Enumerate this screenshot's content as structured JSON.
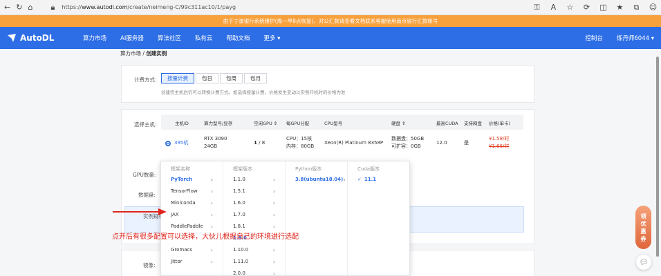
{
  "browser": {
    "url_prefix": "https://",
    "url_host": "www.autodl.com",
    "url_path": "/create/neimeng-C/99c311ac10/1/payg"
  },
  "notice": {
    "text": "由于宁波银行系统维护(周一早8点恢复)，对公汇款请查看文档联系客服使用南京银行汇款账号"
  },
  "nav": {
    "brand": "AutoDL",
    "items": [
      "算力市场",
      "AI服务器",
      "算法社区",
      "私有云",
      "帮助文档",
      "更多"
    ],
    "console": "控制台",
    "user": "炼丹师6044"
  },
  "breadcrumb": {
    "root": "算力市场",
    "separator": "/",
    "current": "创建实例"
  },
  "billing": {
    "label": "计费方式:",
    "options": [
      "按量计费",
      "包日",
      "包周",
      "包月"
    ],
    "selected": "按量计费",
    "hint": "创建完主机后仍可以转换计费方式。如选择按量计费，价格发生变动以实例开机时的价格为准"
  },
  "host": {
    "label": "选择主机:",
    "headers": [
      "主机ID",
      "算力型号/显存",
      "空闲GPU",
      "每GPU分配",
      "CPU型号",
      "硬盘",
      "最高CUDA",
      "支持网盘",
      "价格(单卡)"
    ],
    "row": {
      "id": "395机",
      "gpu_model": "RTX 3090",
      "gpu_mem": "24GB",
      "free_gpu": "1",
      "total_gpu": "/ 8",
      "cpu_alloc": "CPU：15核",
      "mem_alloc": "内存：80GB",
      "cpu_model": "Xeon(R) Platinum 8358P",
      "disk_data": "数据盘：50GB",
      "disk_expand": "可扩容：0GB",
      "cuda": "12.0",
      "netdisk": "是",
      "price_new": "¥1.58/时",
      "price_old": "¥1.66/时"
    }
  },
  "labels": {
    "gpu_count": "GPU数量:",
    "data_disk": "数据盘:",
    "instance_spec": "实例规格",
    "image": "镜像:"
  },
  "cascade": {
    "headers": [
      "框架名称",
      "框架版本",
      "Python版本",
      "Cuda版本"
    ],
    "frameworks": [
      "PyTorch",
      "TensorFlow",
      "Miniconda",
      "JAX",
      "PaddlePaddle",
      "",
      "Gromacs",
      "Jittor"
    ],
    "versions": [
      "1.1.0",
      "1.5.1",
      "1.6.0",
      "1.7.0",
      "1.8.1",
      "1.9.0",
      "1.10.0",
      "1.11.0",
      "2.0.0"
    ],
    "python": [
      "3.8(ubuntu18.04)"
    ],
    "cuda": [
      "11.1"
    ]
  },
  "annotation": {
    "text": "点开后有很多配置可以选择，大伙儿根据自己的环境进行选配"
  },
  "float_badge": {
    "chars": [
      "领",
      "优",
      "惠",
      "券"
    ]
  },
  "colors": {
    "brand": "#2d6ee6",
    "notice": "#f7a13d",
    "annotation": "#e0241b",
    "price": "#e03a1e"
  }
}
